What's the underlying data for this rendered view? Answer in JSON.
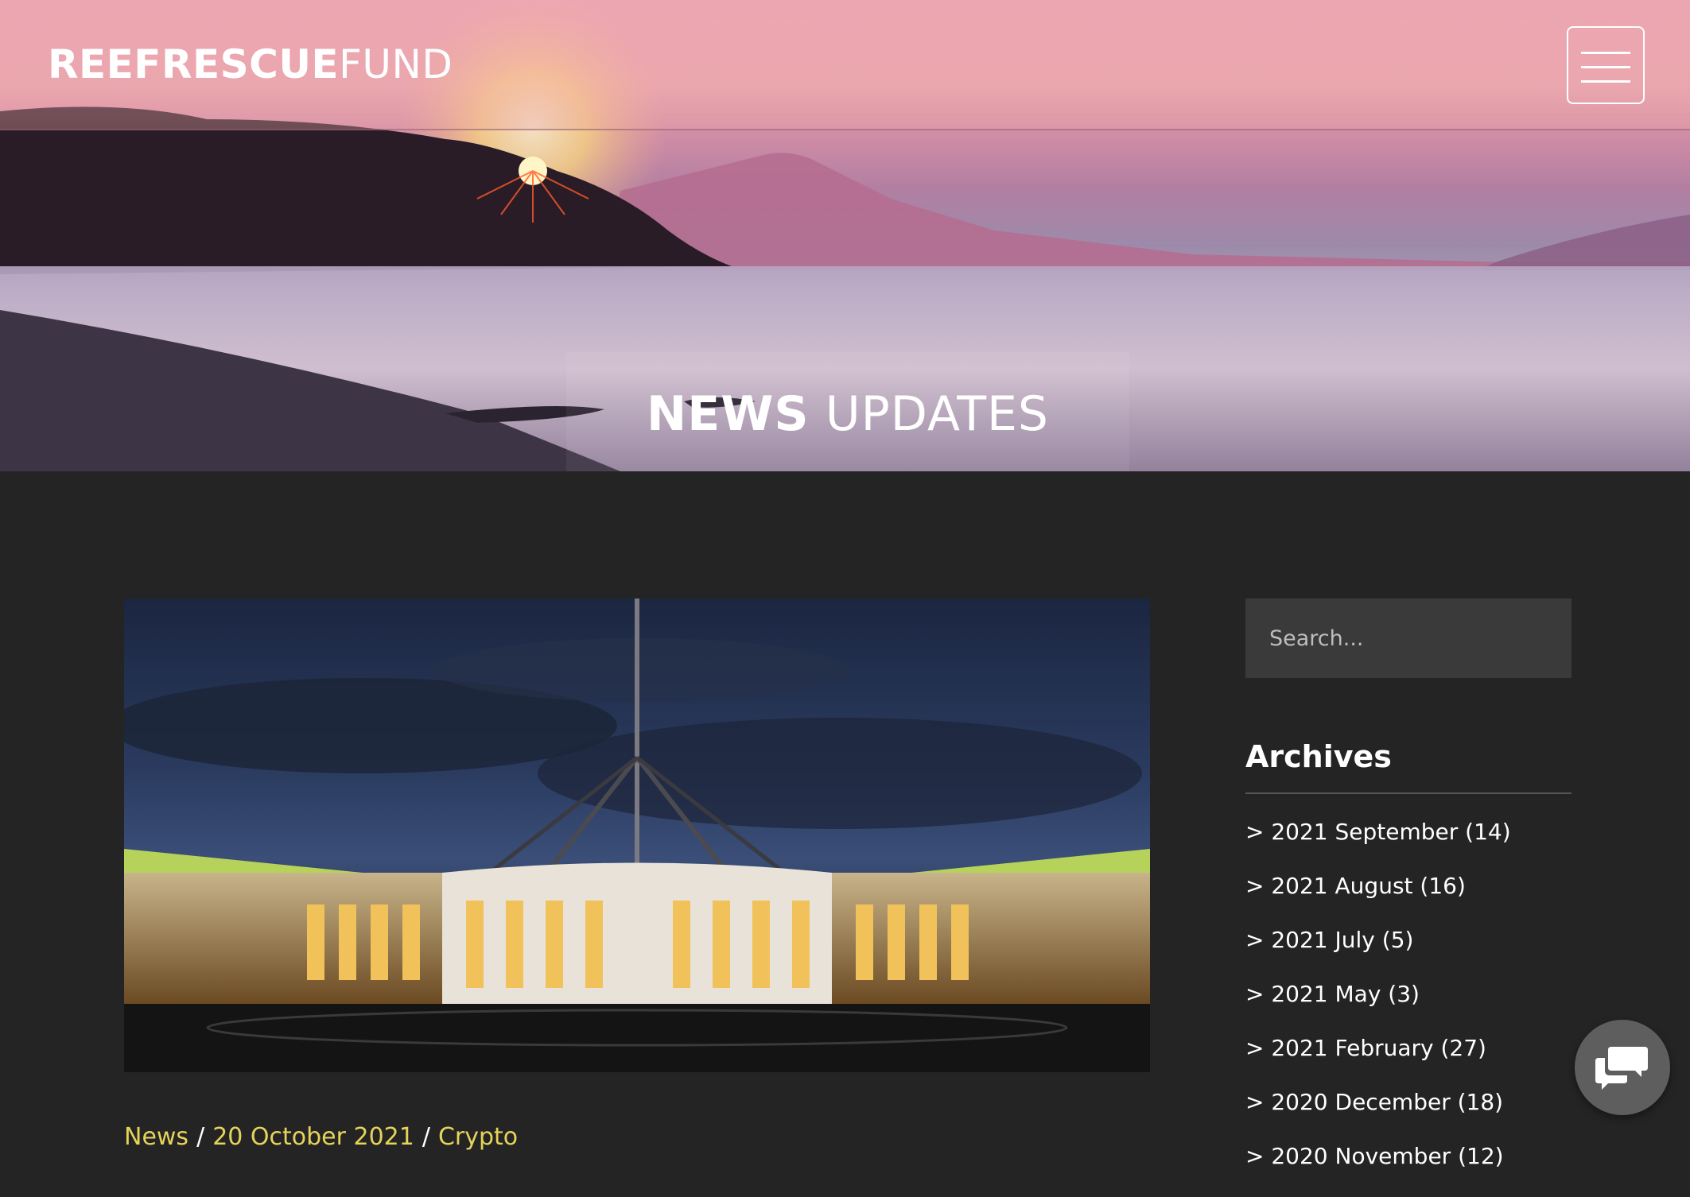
{
  "header": {
    "brand_bold": "REEFRESCUE",
    "brand_light": "FUND",
    "menu_icon": "hamburger-icon"
  },
  "hero": {
    "title_bold": "NEWS",
    "title_light": "UPDATES"
  },
  "post": {
    "category": "News",
    "date": "20 October 2021",
    "tag": "Crypto",
    "separator": "/"
  },
  "sidebar": {
    "search_placeholder": "Search...",
    "archives_title": "Archives",
    "archives": [
      "> 2021 September (14)",
      "> 2021 August (16)",
      "> 2021 July (5)",
      "> 2021 May (3)",
      "> 2021 February (27)",
      "> 2020 December (18)",
      "> 2020 November (12)"
    ]
  },
  "chat": {
    "icon": "chat-bubbles-icon"
  },
  "colors": {
    "page_bg": "#242424",
    "meta_accent": "#e6d35a",
    "search_bg": "#3a3a3a"
  }
}
